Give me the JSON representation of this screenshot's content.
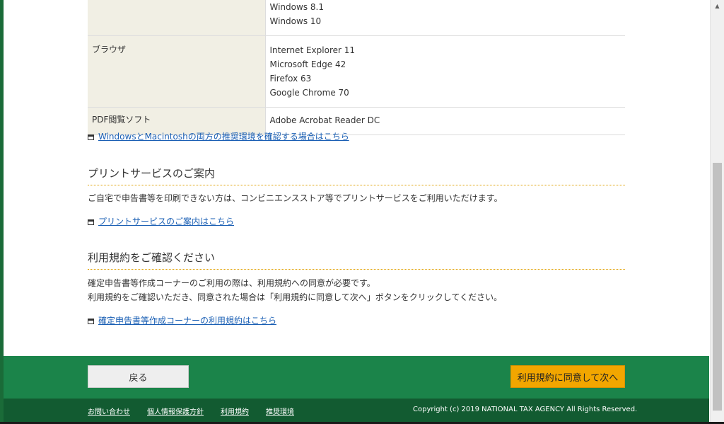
{
  "spec_table": {
    "rows": [
      {
        "header": "",
        "values": [
          "Windows 8.1",
          "Windows 10"
        ]
      },
      {
        "header": "ブラウザ",
        "values": [
          "Internet Explorer 11",
          "Microsoft Edge 42",
          "Firefox 63",
          "Google Chrome 70"
        ]
      },
      {
        "header": "PDF閲覧ソフト",
        "values": [
          "Adobe Acrobat Reader DC"
        ]
      }
    ]
  },
  "links": {
    "env_both": "WindowsとMacintoshの両方の推奨環境を確認する場合はこちら",
    "print_service": "プリントサービスのご案内はこちら",
    "terms": "確定申告書等作成コーナーの利用規約はこちら"
  },
  "print_section": {
    "title": "プリントサービスのご案内",
    "text": "ご自宅で申告書等を印刷できない方は、コンビニエンスストア等でプリントサービスをご利用いただけます。"
  },
  "terms_section": {
    "title": "利用規約をご確認ください",
    "text1": "確定申告書等作成コーナーのご利用の際は、利用規約への同意が必要です。",
    "text2": "利用規約をご確認いただき、同意された場合は「利用規約に同意して次へ」ボタンをクリックしてください。"
  },
  "buttons": {
    "back": "戻る",
    "agree_next": "利用規約に同意して次へ"
  },
  "footer": {
    "links": [
      "お問い合わせ",
      "個人情報保護方針",
      "利用規約",
      "推奨環境"
    ],
    "copyright": "Copyright (c) 2019 NATIONAL TAX AGENCY All Rights Reserved."
  },
  "colors": {
    "footer_green": "#1b844a",
    "footer_dark_green": "#125b31",
    "accent_orange": "#f2a600",
    "link_blue": "#1a5fb4"
  },
  "icons": {
    "external_window": "window-icon",
    "scroll_up": "chevron-up-icon"
  }
}
